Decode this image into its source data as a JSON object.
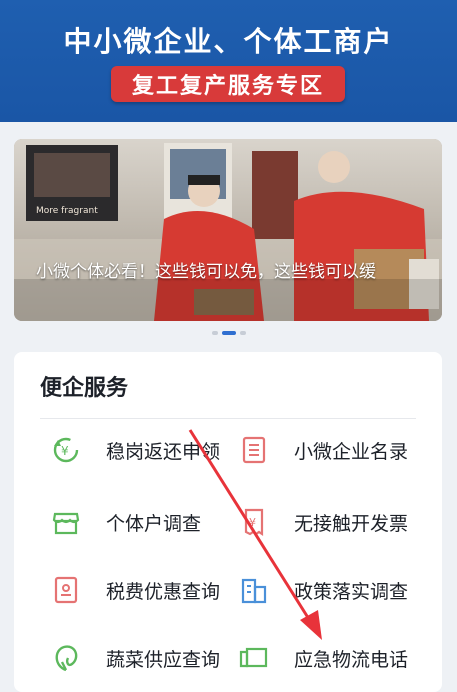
{
  "header": {
    "title": "中小微企业、个体工商户",
    "badge": "复工复产服务专区"
  },
  "banner": {
    "caption": "小微个体必看！这些钱可以免，这些钱可以缓",
    "poster_text": "More fragrant",
    "slides": 3,
    "active_slide": 2
  },
  "services": {
    "title": "便企服务",
    "items": [
      {
        "label": "稳岗返还申领",
        "icon": "refund-cycle-icon",
        "color": "#5cb85c"
      },
      {
        "label": "小微企业名录",
        "icon": "list-document-icon",
        "color": "#e57373"
      },
      {
        "label": "个体户调查",
        "icon": "shop-icon",
        "color": "#5cb85c"
      },
      {
        "label": "无接触开发票",
        "icon": "invoice-icon",
        "color": "#e57373"
      },
      {
        "label": "税费优惠查询",
        "icon": "tax-card-icon",
        "color": "#e57373"
      },
      {
        "label": "政策落实调查",
        "icon": "building-icon",
        "color": "#4a90d9"
      },
      {
        "label": "蔬菜供应查询",
        "icon": "leaf-icon",
        "color": "#5cb85c"
      },
      {
        "label": "应急物流电话",
        "icon": "truck-icon",
        "color": "#5cb85c"
      }
    ]
  },
  "annotation": {
    "color": "#e8333a"
  }
}
